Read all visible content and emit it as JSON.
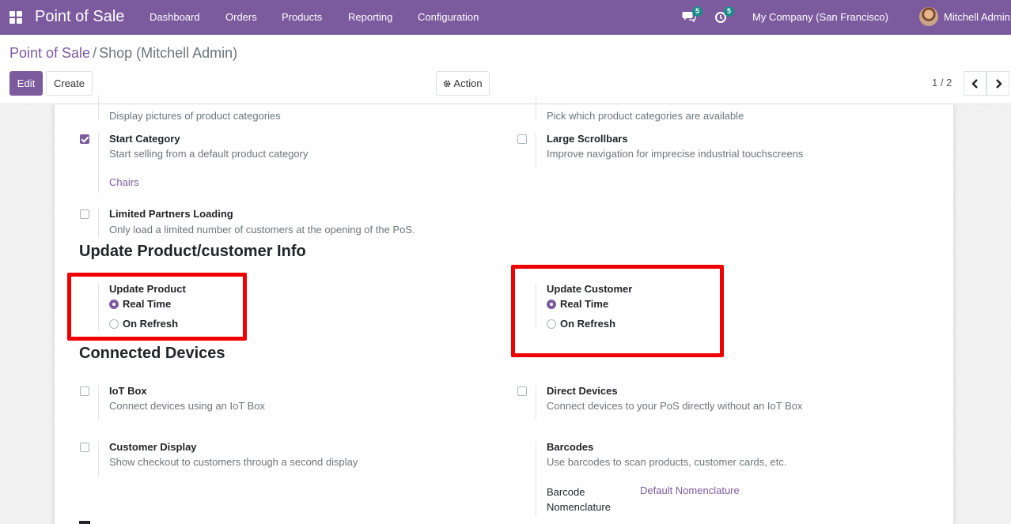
{
  "navbar": {
    "app_name": "Point of Sale",
    "menu": [
      "Dashboard",
      "Orders",
      "Products",
      "Reporting",
      "Configuration"
    ],
    "messages_count": "5",
    "activities_count": "5",
    "company": "My Company (San Francisco)",
    "user": "Mitchell Admin"
  },
  "breadcrumb": {
    "parent": "Point of Sale",
    "separator": "/",
    "current": "Shop (Mitchell Admin)"
  },
  "toolbar": {
    "edit_label": "Edit",
    "create_label": "Create",
    "action_label": "Action",
    "pager": "1 / 2"
  },
  "settings": {
    "category_pictures": {
      "desc": "Display pictures of product categories"
    },
    "available_categories": {
      "desc": "Pick which product categories are available"
    },
    "start_category": {
      "title": "Start Category",
      "desc": "Start selling from a default product category",
      "value": "Chairs",
      "checked": true
    },
    "large_scrollbars": {
      "title": "Large Scrollbars",
      "desc": "Improve navigation for imprecise industrial touchscreens",
      "checked": false
    },
    "limited_partners": {
      "title": "Limited Partners Loading",
      "desc": "Only load a limited number of customers at the opening of the PoS.",
      "checked": false
    }
  },
  "update_section": {
    "title": "Update Product/customer Info",
    "product": {
      "title": "Update Product",
      "options": [
        "Real Time",
        "On Refresh"
      ],
      "selected": "Real Time"
    },
    "customer": {
      "title": "Update Customer",
      "options": [
        "Real Time",
        "On Refresh"
      ],
      "selected": "Real Time"
    }
  },
  "devices_section": {
    "title": "Connected Devices",
    "iot_box": {
      "title": "IoT Box",
      "desc": "Connect devices using an IoT Box",
      "checked": false
    },
    "direct_devices": {
      "title": "Direct Devices",
      "desc": "Connect devices to your PoS directly without an IoT Box",
      "checked": false
    },
    "customer_display": {
      "title": "Customer Display",
      "desc": "Show checkout to customers through a second display",
      "checked": false
    },
    "barcodes": {
      "title": "Barcodes",
      "desc": "Use barcodes to scan products, customer cards, etc.",
      "field_label_1": "Barcode",
      "field_label_2": "Nomenclature",
      "value": "Default Nomenclature"
    }
  },
  "colors": {
    "brand": "#7c5a9e",
    "badge": "#1b8c87",
    "highlight": "#ee0000"
  }
}
